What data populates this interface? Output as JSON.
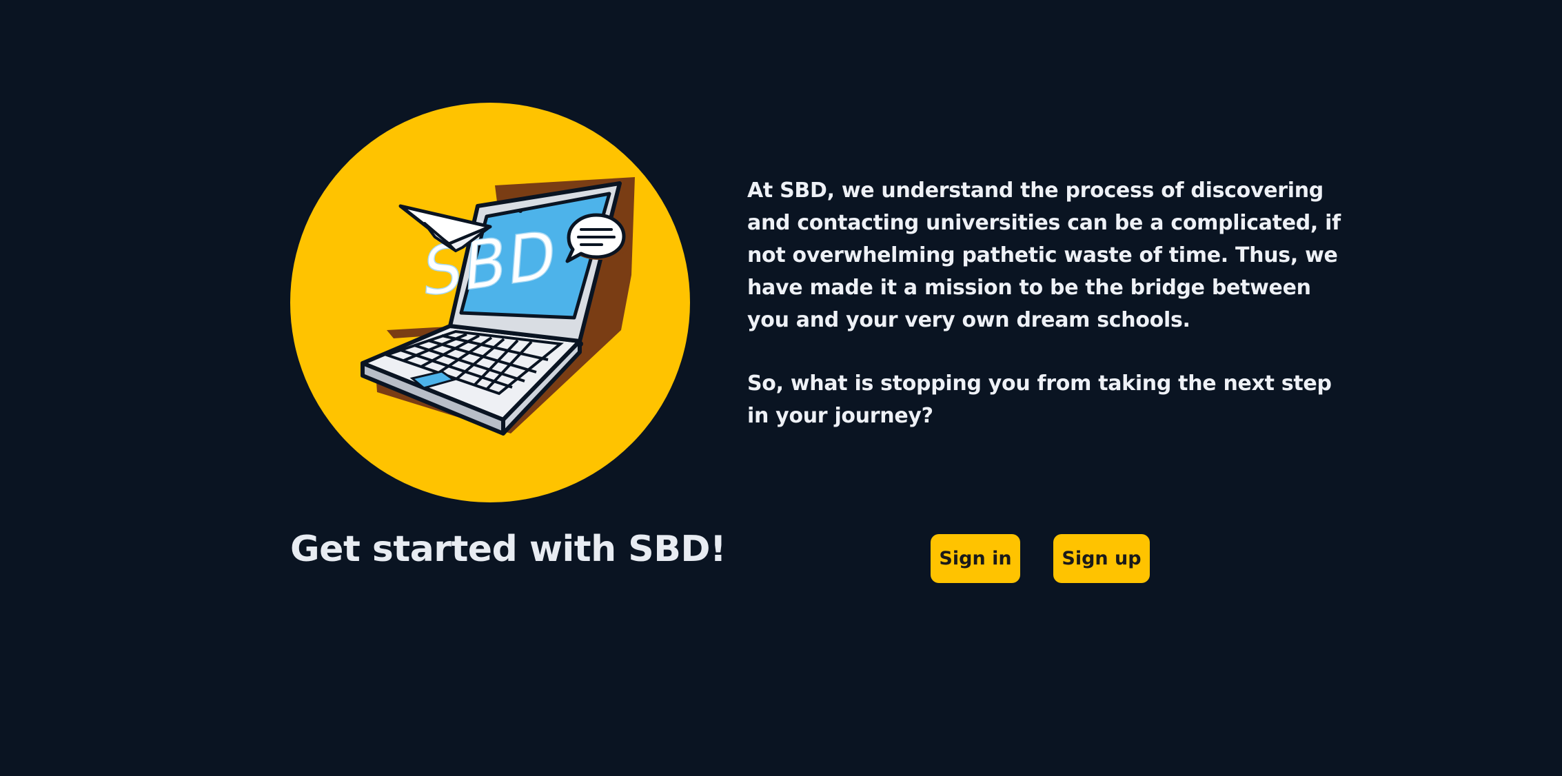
{
  "hero": {
    "logo_text": "SBD",
    "headline": "Get started with SBD!"
  },
  "content": {
    "intro": "At SBD, we understand the process of discovering and contacting universities can be a complicated, if not overwhelming pathetic waste of time. Thus, we have made it a mission to be the bridge between you and your very own dream schools.",
    "question": "So, what is stopping you from taking the next step in your journey?"
  },
  "actions": {
    "sign_in_label": "Sign in",
    "sign_up_label": "Sign up"
  },
  "colors": {
    "background": "#0a1422",
    "accent": "#ffc300",
    "text": "#eef1f6",
    "screen": "#4db3ea"
  },
  "icons": [
    "laptop-icon",
    "paper-plane-icon",
    "chat-bubble-icon"
  ]
}
